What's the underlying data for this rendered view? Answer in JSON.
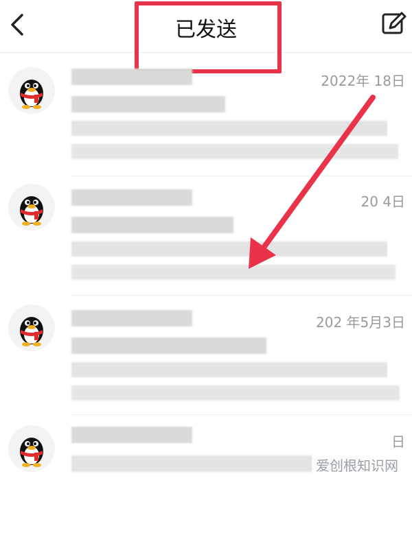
{
  "header": {
    "title": "已发送",
    "back_icon": "back-chevron-icon",
    "compose_icon": "compose-edit-icon"
  },
  "mails": [
    {
      "date": "2022年  18日"
    },
    {
      "date": "20    4日"
    },
    {
      "date": "202  年5月3日"
    },
    {
      "date": "    日"
    }
  ],
  "watermark": "爱创根知识网",
  "colors": {
    "annotation": "#e8334a",
    "date": "#9a9a9a",
    "blur": "#d9d9d9",
    "scarf": "#e02b2b"
  }
}
